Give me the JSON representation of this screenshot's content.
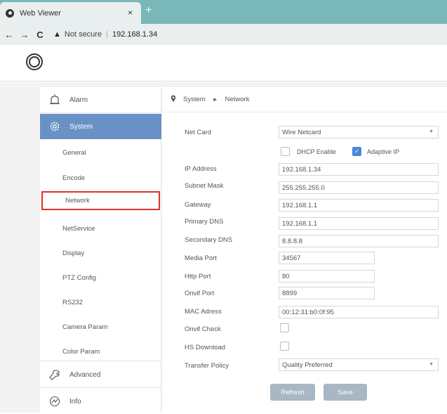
{
  "browser": {
    "tab_title": "Web Viewer",
    "tab_close": "×",
    "new_tab": "+",
    "back": "←",
    "forward": "→",
    "reload": "C",
    "warning": "▲",
    "not_secure": "Not secure",
    "separator": "|",
    "host": "192.168.1.34"
  },
  "sidebar": {
    "items": [
      {
        "label": "Alarm",
        "icon": "alarm-icon"
      },
      {
        "label": "System",
        "icon": "system-gear-icon"
      }
    ],
    "sub_items": [
      "General",
      "Encode",
      "Network",
      "NetService",
      "Display",
      "PTZ Config",
      "RS232",
      "Camera Param",
      "Color Param"
    ],
    "bottom_items": [
      {
        "label": "Advanced",
        "icon": "wrench-icon"
      },
      {
        "label": "Info",
        "icon": "info-icon"
      }
    ]
  },
  "breadcrumb": {
    "root": "System",
    "arrow": "►",
    "current": "Network"
  },
  "form": {
    "net_card": {
      "label": "Net Card",
      "value": "Wire Netcard"
    },
    "dhcp_enable": {
      "label": "DHCP Enable",
      "checked": false
    },
    "adaptive_ip": {
      "label": "Adaptive IP",
      "checked": true
    },
    "ip_address": {
      "label": "IP Address",
      "value": "192.168.1.34"
    },
    "subnet_mask": {
      "label": "Subnet Mask",
      "value": "255.255.255.0"
    },
    "gateway": {
      "label": "Gateway",
      "value": "192.168.1.1"
    },
    "primary_dns": {
      "label": "Primary DNS",
      "value": "192.168.1.1"
    },
    "secondary_dns": {
      "label": "Secondary DNS",
      "value": "8.8.8.8"
    },
    "media_port": {
      "label": "Media Port",
      "value": "34567"
    },
    "http_port": {
      "label": "Http Port",
      "value": "80"
    },
    "onvif_port": {
      "label": "Onvif Port",
      "value": "8899"
    },
    "mac_address": {
      "label": "MAC Adress",
      "value": "00:12:31:b0:0f:95"
    },
    "onvif_check": {
      "label": "Onvif Check",
      "checked": false
    },
    "hs_download": {
      "label": "HS Download",
      "checked": false
    },
    "transfer_policy": {
      "label": "Transfer Policy",
      "value": "Quality Preferred"
    }
  },
  "buttons": {
    "refresh": "Refresh",
    "save": "Save"
  },
  "colors": {
    "tabbar": "#79b7b9",
    "sidebar_active": "#6a91c6",
    "highlight_box": "#e03030",
    "button": "#a9b6c3",
    "checkbox_checked": "#4a86d6"
  }
}
